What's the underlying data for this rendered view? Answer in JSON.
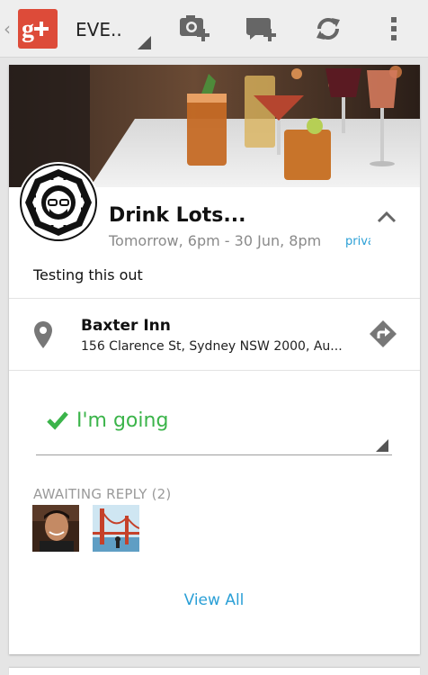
{
  "actionbar": {
    "app_name": "Google+",
    "section_title": "EVE..",
    "actions": [
      {
        "icon": "add-photo-icon"
      },
      {
        "icon": "add-comment-icon"
      },
      {
        "icon": "refresh-icon"
      },
      {
        "icon": "overflow-menu-icon"
      }
    ]
  },
  "event": {
    "title": "Drink Lots...",
    "time": "Tomorrow, 6pm - 30 Jun, 8pm",
    "privacy": "private",
    "description": "Testing this out"
  },
  "location": {
    "name": "Baxter Inn",
    "address": "156 Clarence St, Sydney NSW 2000, Au..."
  },
  "rsvp": {
    "label": "I'm going",
    "color": "#3bb44a"
  },
  "awaiting": {
    "header": "AWAITING REPLY (2)",
    "count": 2
  },
  "view_all_label": "View All",
  "colors": {
    "brand": "#dd4b39",
    "link": "#2a9fd6",
    "going": "#3bb44a",
    "muted": "#8a8a8a"
  }
}
